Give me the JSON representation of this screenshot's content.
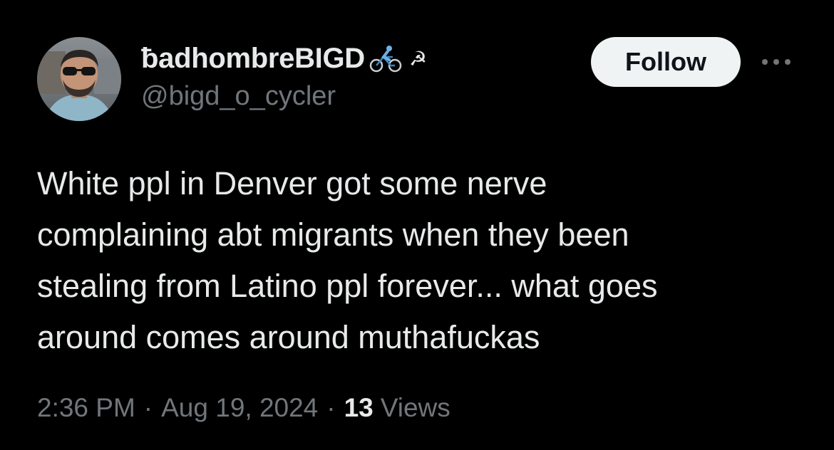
{
  "tweet": {
    "author": {
      "display_name": "ƀadhombreBIGD",
      "name_emoji_1": "biker-emoji",
      "name_emoji_2": "hammer-sickle-emoji",
      "name_emoji_2_glyph": "☭",
      "handle": "@bigd_o_cycler",
      "avatar": "avatar-photo"
    },
    "follow_label": "Follow",
    "more_icon": "more-dots-icon",
    "text": "White ppl in Denver got some nerve\ncomplaining abt migrants when they been\nstealing from Latino ppl forever... what goes\naround comes around muthafuckas",
    "time": "2:36 PM",
    "separator": "·",
    "date": "Aug 19, 2024",
    "views_count": "13",
    "views_label": "Views"
  },
  "colors": {
    "background": "#000000",
    "primary_text": "#e7e9ea",
    "secondary_text": "#71767b",
    "follow_bg": "#eff3f4",
    "follow_text": "#0f1419"
  }
}
